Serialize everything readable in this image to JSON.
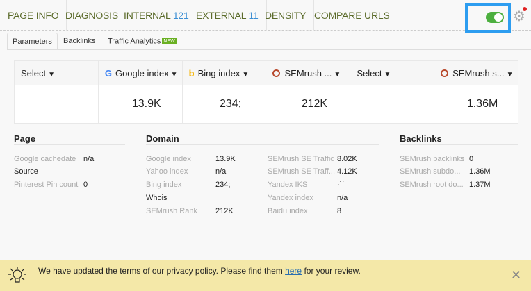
{
  "nav": [
    {
      "label": "PAGE INFO",
      "count": ""
    },
    {
      "label": "DIAGNOSIS",
      "count": ""
    },
    {
      "label": "INTERNAL",
      "count": "121"
    },
    {
      "label": "EXTERNAL",
      "count": "11"
    },
    {
      "label": "DENSITY",
      "count": ""
    },
    {
      "label": "COMPARE URLS",
      "count": ""
    }
  ],
  "toggle": {
    "on": true,
    "color": "#4caf3f"
  },
  "subtabs": {
    "parameters": "Parameters",
    "backlinks": "Backlinks",
    "traffic": "Traffic Analytics",
    "new_badge": "NEW"
  },
  "table": {
    "headers": [
      {
        "label": "Select",
        "icon": ""
      },
      {
        "label": "Google index",
        "icon": "google-icon"
      },
      {
        "label": "Bing index",
        "icon": "bing-icon"
      },
      {
        "label": "SEMrush ...",
        "icon": "semrush-icon"
      },
      {
        "label": "Select",
        "icon": ""
      },
      {
        "label": "SEMrush s...",
        "icon": "semrush-icon"
      }
    ],
    "values": [
      "",
      "13.9K",
      "234;",
      "212K",
      "",
      "1.36M"
    ]
  },
  "page": {
    "title": "Page",
    "rows": [
      {
        "label": "Google cachedate",
        "value": "n/a"
      },
      {
        "label": "Source",
        "value": ""
      },
      {
        "label": "Pinterest Pin count",
        "value": "0"
      }
    ]
  },
  "domain": {
    "title": "Domain",
    "col1": [
      {
        "label": "Google index",
        "value": "13.9K"
      },
      {
        "label": "Yahoo index",
        "value": "n/a"
      },
      {
        "label": "Bing index",
        "value": "234;"
      },
      {
        "label": "Whois",
        "value": ""
      },
      {
        "label": "SEMrush Rank",
        "value": "212K"
      }
    ],
    "col2": [
      {
        "label": "SEMrush SE Traffic",
        "value": "8.02K"
      },
      {
        "label": "SEMrush SE Traff...",
        "value": "4.12K"
      },
      {
        "label": "Yandex IKS",
        "value": "·˙˙"
      },
      {
        "label": "Yandex index",
        "value": "n/a"
      },
      {
        "label": "Baidu index",
        "value": "8"
      }
    ]
  },
  "backlinks": {
    "title": "Backlinks",
    "rows": [
      {
        "label": "SEMrush backlinks",
        "value": "0"
      },
      {
        "label": "SEMrush subdo...",
        "value": "1.36M"
      },
      {
        "label": "SEMrush root do...",
        "value": "1.37M"
      }
    ]
  },
  "banner": {
    "before": "We have updated the terms of our privacy policy. Please find them ",
    "link": "here",
    "after": " for your review."
  }
}
